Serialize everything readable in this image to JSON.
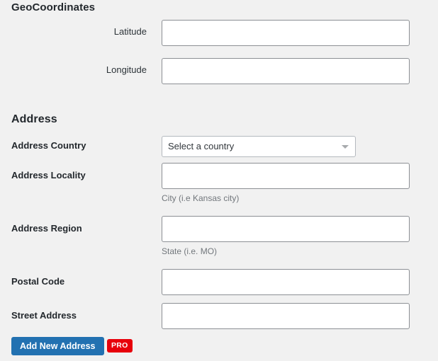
{
  "theme": {
    "background": "#f1f1f1",
    "input_border": "#8c8f94",
    "primary_blue": "#2271b1",
    "badge_red": "#e7000b",
    "help_text_color": "#72777c"
  },
  "geo_section": {
    "heading": "GeoCoordinates",
    "fields": [
      {
        "label": "Latitude",
        "value": "",
        "placeholder": ""
      },
      {
        "label": "Longitude",
        "value": "",
        "placeholder": ""
      }
    ]
  },
  "address_section": {
    "heading": "Address",
    "country": {
      "label": "Address Country",
      "selected": "Select a country",
      "icon": "chevron-down-icon"
    },
    "locality": {
      "label": "Address Locality",
      "value": "",
      "placeholder": "",
      "help": "City (i.e Kansas city)"
    },
    "region": {
      "label": "Address Region",
      "value": "",
      "placeholder": "",
      "help": "State (i.e. MO)"
    },
    "postal_code": {
      "label": "Postal Code",
      "value": "",
      "placeholder": ""
    },
    "street_address": {
      "label": "Street Address",
      "value": "",
      "placeholder": ""
    }
  },
  "footer": {
    "add_button_label": "Add New Address",
    "pro_badge_label": "PRO"
  }
}
